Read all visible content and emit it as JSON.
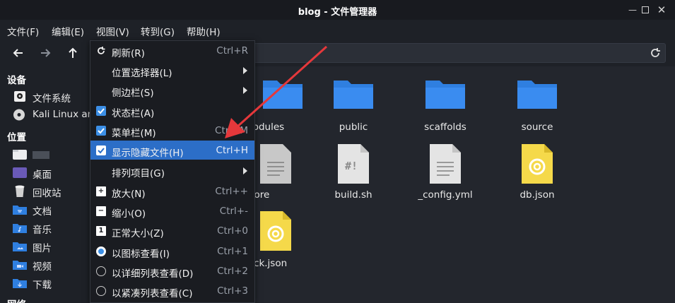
{
  "window": {
    "title": "blog - 文件管理器"
  },
  "menubar": {
    "items": [
      "文件(F)",
      "编辑(E)",
      "视图(V)",
      "转到(G)",
      "帮助(H)"
    ]
  },
  "sidebar": {
    "devices_heading": "设备",
    "devices": [
      "文件系统",
      "Kali Linux an"
    ],
    "places_heading": "位置",
    "places": [
      "",
      "桌面",
      "回收站",
      "文档",
      "音乐",
      "图片",
      "视频",
      "下载"
    ],
    "network_heading": "网络"
  },
  "files": [
    {
      "name": "node_modules",
      "display": "_modules",
      "type": "folder"
    },
    {
      "name": "public",
      "display": "public",
      "type": "folder"
    },
    {
      "name": "scaffolds",
      "display": "scaffolds",
      "type": "folder"
    },
    {
      "name": "source",
      "display": "source",
      "type": "folder"
    },
    {
      "name": ".gitignore",
      "display": "ignore",
      "type": "text"
    },
    {
      "name": "build.sh",
      "display": "build.sh",
      "type": "script"
    },
    {
      "name": "_config.yml",
      "display": "_config.yml",
      "type": "text"
    },
    {
      "name": "db.json",
      "display": "db.json",
      "type": "json"
    },
    {
      "name": "package-lock.json",
      "display": "e-lock.json",
      "type": "json"
    }
  ],
  "view_menu": {
    "items": [
      {
        "label": "刷新(R)",
        "accel": "Ctrl+R",
        "icon": "reload-icon"
      },
      {
        "label": "位置选择器(L)",
        "accel": "",
        "submenu": true
      },
      {
        "label": "侧边栏(S)",
        "accel": "",
        "submenu": true
      },
      {
        "label": "状态栏(A)",
        "accel": "",
        "checked": true
      },
      {
        "label": "菜单栏(M)",
        "accel": "Ctrl+M",
        "checked": true
      },
      {
        "label": "显示隐藏文件(H)",
        "accel": "Ctrl+H",
        "checked": true,
        "highlighted": true
      },
      {
        "label": "排列项目(G)",
        "accel": "",
        "submenu": true
      },
      {
        "label": "放大(N)",
        "accel": "Ctrl++",
        "icon": "zoom-in-icon"
      },
      {
        "label": "缩小(O)",
        "accel": "Ctrl+-",
        "icon": "zoom-out-icon"
      },
      {
        "label": "正常大小(Z)",
        "accel": "Ctrl+0",
        "icon": "zoom-normal-icon"
      },
      {
        "label": "以图标查看(I)",
        "accel": "Ctrl+1",
        "radio": true,
        "selected": true
      },
      {
        "label": "以详细列表查看(D)",
        "accel": "Ctrl+2",
        "radio": true,
        "selected": false
      },
      {
        "label": "以紧凑列表查看(C)",
        "accel": "Ctrl+3",
        "radio": true,
        "selected": false
      }
    ]
  },
  "colors": {
    "accent": "#3c8fe6",
    "folder": "#2f7fe0",
    "highlight": "#2c6ec7",
    "annotation_arrow": "#e5383b"
  }
}
